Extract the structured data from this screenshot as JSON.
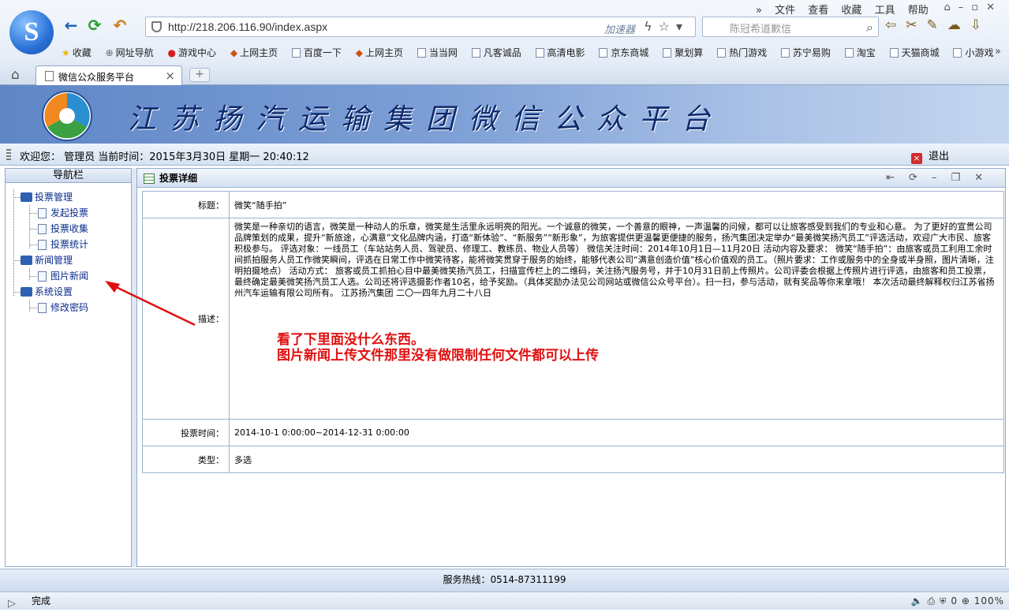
{
  "browser": {
    "menu": [
      "文件",
      "查看",
      "收藏",
      "工具",
      "帮助"
    ],
    "url": "http://218.206.116.90/index.aspx",
    "accelerator": "加速器",
    "search_placeholder": "陈冠希道歉信",
    "favorites": [
      {
        "label": "收藏",
        "icon": "star-icon"
      },
      {
        "label": "网址导航",
        "icon": "globe-icon"
      },
      {
        "label": "游戏中心",
        "icon": "game-icon"
      },
      {
        "label": "上网主页",
        "icon": "hao-icon"
      },
      {
        "label": "百度一下",
        "icon": "page-icon"
      },
      {
        "label": "上网主页",
        "icon": "hao-icon"
      },
      {
        "label": "当当网",
        "icon": "page-icon"
      },
      {
        "label": "凡客诚品",
        "icon": "page-icon"
      },
      {
        "label": "高清电影",
        "icon": "page-icon"
      },
      {
        "label": "京东商城",
        "icon": "page-icon"
      },
      {
        "label": "聚划算",
        "icon": "page-icon"
      },
      {
        "label": "热门游戏",
        "icon": "page-icon"
      },
      {
        "label": "苏宁易购",
        "icon": "page-icon"
      },
      {
        "label": "淘宝",
        "icon": "page-icon"
      },
      {
        "label": "天猫商城",
        "icon": "page-icon"
      },
      {
        "label": "小游戏",
        "icon": "page-icon"
      }
    ],
    "tab_title": "微信公众服务平台",
    "status_text": "完成",
    "status_count": "0",
    "zoom": "100%"
  },
  "header": {
    "title": "江苏扬汽运输集团微信公众平台"
  },
  "infobar": {
    "welcome": "欢迎您： 管理员 当前时间：2015年3月30日 星期一 20:40:12",
    "logout": "退出"
  },
  "sidebar": {
    "title": "导航栏",
    "groups": [
      {
        "label": "投票管理",
        "items": [
          "发起投票",
          "投票收集",
          "投票统计"
        ]
      },
      {
        "label": "新闻管理",
        "items": [
          "图片新闻"
        ]
      },
      {
        "label": "系统设置",
        "items": [
          "修改密码"
        ]
      }
    ]
  },
  "main": {
    "panel_title": "投票详细",
    "rows": {
      "title_label": "标题：",
      "title_value": "微笑“随手拍”",
      "desc_label": "描述：",
      "desc_value": "微笑是一种亲切的语言，微笑是一种动人的乐章，微笑是生活里永远明亮的阳光。一个诚意的微笑，一个善意的眼神，一声温馨的问候，都可以让旅客感受到我们的专业和心意。 为了更好的宣贯公司品牌策划的成果，提升“新旅途，心满意”文化品牌内涵，打造“新体验”、“新服务”“新形象”，为旅客提供更温馨更便捷的服务，扬汽集团决定举办“最美微笑扬汽员工”评选活动，欢迎广大市民、旅客积极参与。 评选对象：一线员工（车站站务人员、驾驶员、修理工、教练员、物业人员等） 微信关注时间：2014年10月1日—11月20日 活动内容及要求： 微笑“随手拍”：由旅客或员工利用工余时间抓拍服务人员工作微笑瞬间，评选在日常工作中微笑待客，能将微笑贯穿于服务的始终，能够代表公司“满意创造价值”核心价值观的员工。（照片要求：工作或服务中的全身或半身照，图片清晰，注明拍摄地点） 活动方式： 旅客或员工抓拍心目中最美微笑扬汽员工，扫描宣传栏上的二维码，关注扬汽服务号，并于10月31日前上传照片。公司评委会根据上传照片进行评选，由旅客和员工投票，最终确定最美微笑扬汽员工人选。公司还将评选摄影作者10名，给予奖励。（具体奖励办法见公司网站或微信公众号平台）。扫一扫，参与活动，就有奖品等你来拿哦！ 本次活动最终解释权归江苏省扬州汽车运输有限公司所有。 江苏扬汽集团 二〇一四年九月二十八日",
      "time_label": "投票时间：",
      "time_value": "2014-10-1 0:00:00~2014-12-31 0:00:00",
      "type_label": "类型：",
      "type_value": "多选"
    }
  },
  "footer": {
    "hotline": "服务热线：0514-87311199"
  },
  "annotation": {
    "line1": "看了下里面没什么东西。",
    "line2": "图片新闻上传文件那里没有做限制任何文件都可以上传"
  }
}
